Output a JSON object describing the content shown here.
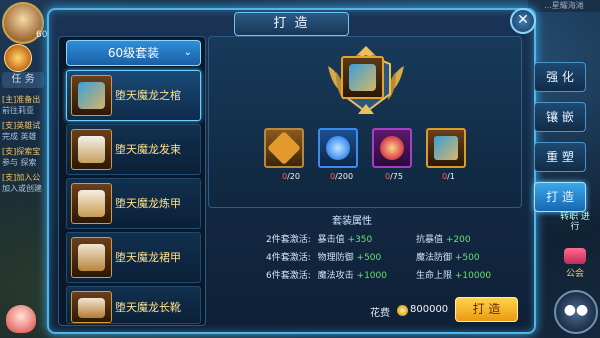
{
  "window": {
    "title": "打  造",
    "close_symbol": "✕"
  },
  "background": {
    "player_level": "60",
    "task_tab": "任 务",
    "quests": [
      {
        "title": "[主]准备出",
        "detail": "前往莉亚"
      },
      {
        "title": "[支]英雄试",
        "detail": "完成 英雄"
      },
      {
        "title": "[支]探索宝",
        "detail": "参与 探索"
      },
      {
        "title": "[支]加入公",
        "detail": "加入或创建"
      }
    ],
    "top_right_text": "...星耀海滩",
    "side_label": "转职\n进行",
    "guild_label": "公会",
    "chat_symbol": "●●"
  },
  "set_list": {
    "header": "60级套装",
    "chevron": "⌄",
    "items": [
      {
        "label": "堕天魔龙之棺",
        "active": true
      },
      {
        "label": "堕天魔龙发束",
        "active": false
      },
      {
        "label": "堕天魔龙炼甲",
        "active": false
      },
      {
        "label": "堕天魔龙裙甲",
        "active": false
      },
      {
        "label": "堕天魔龙长靴",
        "active": false
      }
    ]
  },
  "materials": [
    {
      "name": "star-shard",
      "count_have": "0",
      "count_need": "/20",
      "color": "#e39a2c"
    },
    {
      "name": "blue-potion",
      "count_have": "0",
      "count_need": "/200",
      "color": "#3b8cf0"
    },
    {
      "name": "fire-orb",
      "count_have": "0",
      "count_need": "/75",
      "color": "#d43b4a"
    },
    {
      "name": "scroll",
      "count_have": "0",
      "count_need": "/1",
      "color": "#c98a3a"
    }
  ],
  "set_attributes": {
    "title": "套装属性",
    "rows": [
      {
        "level": "2件套激活:",
        "a_name": "暴击值",
        "a_val": "+350",
        "b_name": "抗暴值",
        "b_val": "+200"
      },
      {
        "level": "4件套激活:",
        "a_name": "物理防御",
        "a_val": "+500",
        "b_name": "魔法防御",
        "b_val": "+500"
      },
      {
        "level": "6件套激活:",
        "a_name": "魔法攻击",
        "a_val": "+1000",
        "b_name": "生命上限",
        "b_val": "+10000"
      }
    ]
  },
  "cost": {
    "label": "花费",
    "value": "800000"
  },
  "forge_button": "打 造",
  "tabs": [
    {
      "label": "强 化",
      "active": false
    },
    {
      "label": "镶 嵌",
      "active": false
    },
    {
      "label": "重 塑",
      "active": false
    },
    {
      "label": "打 造",
      "active": true
    }
  ],
  "colors": {
    "accent": "#4fb6ea",
    "gold": "#ffe08a",
    "stat_green": "#6be06b",
    "deficit_red": "#ff5d5d"
  }
}
